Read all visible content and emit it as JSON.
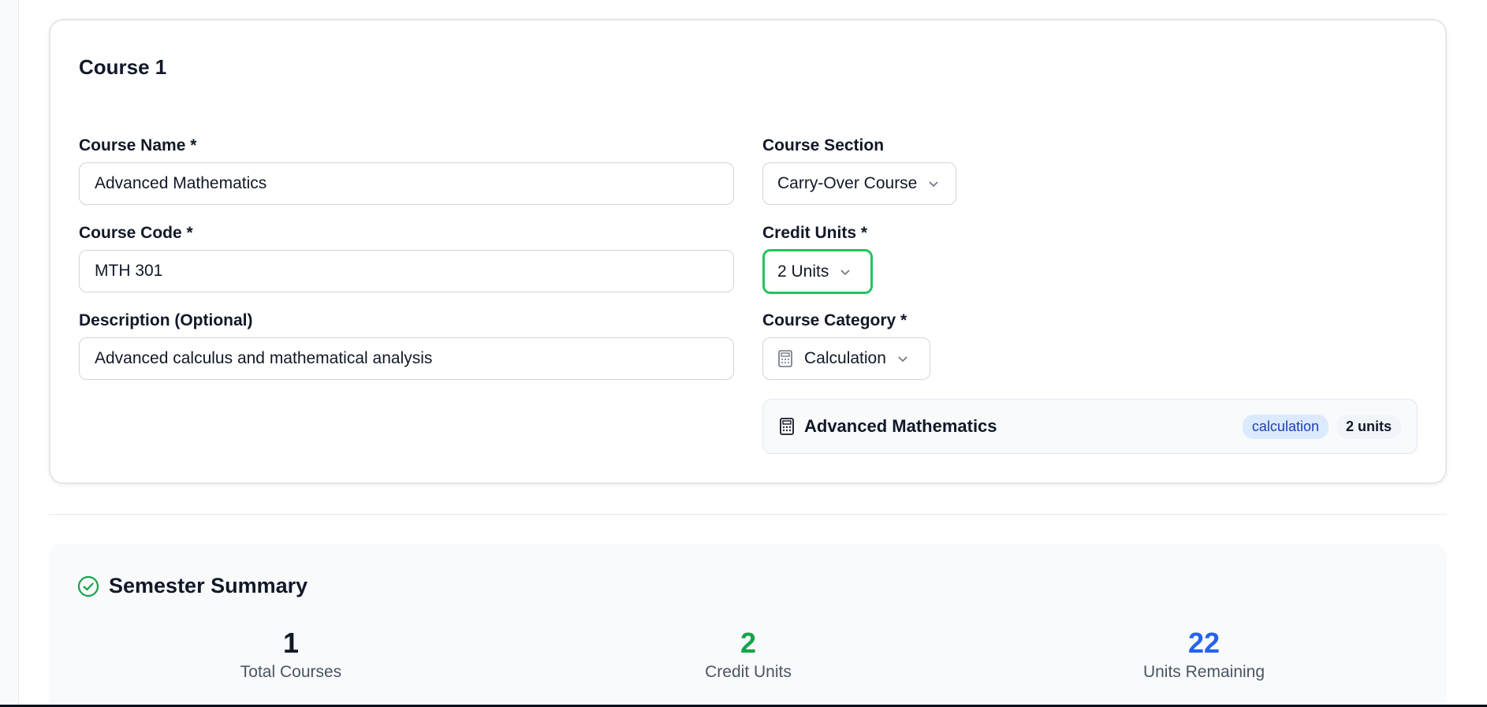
{
  "course": {
    "title": "Course 1",
    "name_label": "Course Name *",
    "name_value": "Advanced Mathematics",
    "code_label": "Course Code *",
    "code_value": "MTH 301",
    "description_label": "Description (Optional)",
    "description_value": "Advanced calculus and mathematical analysis",
    "section_label": "Course Section",
    "section_value": "Carry-Over Course",
    "credit_label": "Credit Units *",
    "credit_value": "2 Units",
    "category_label": "Course Category *",
    "category_value": "Calculation",
    "category_icon": "calculator-icon"
  },
  "preview": {
    "name": "Advanced Mathematics",
    "category_badge": "calculation",
    "units_badge": "2 units",
    "icon": "calculator-icon"
  },
  "summary": {
    "title": "Semester Summary",
    "icon": "check-circle-icon",
    "stats": [
      {
        "value": "1",
        "label": "Total Courses",
        "color": "#111827"
      },
      {
        "value": "2",
        "label": "Credit Units",
        "color": "#16a34a"
      },
      {
        "value": "22",
        "label": "Units Remaining",
        "color": "#2563eb"
      }
    ]
  },
  "colors": {
    "accent_green": "#22c55e",
    "badge_blue_bg": "#dbeafe",
    "badge_blue_text": "#1e40af"
  }
}
